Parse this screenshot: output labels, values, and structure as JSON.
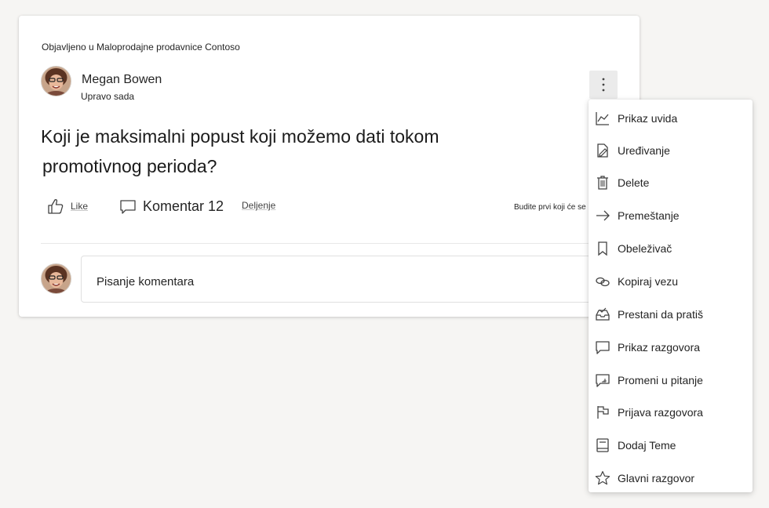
{
  "post": {
    "posted_in": "Objavljeno u Maloprodajne prodavnice Contoso",
    "author": "Megan Bowen",
    "time": "Upravo sada",
    "question_line1": "Koji je maksimalni popust koji možemo dati tokom",
    "question_line2": "promotivnog perioda?"
  },
  "actions": {
    "like": "Like",
    "comment": "Komentar 12",
    "share": "Deljenje",
    "seen": "Budite prvi koji će se razboleti"
  },
  "comment_box": {
    "placeholder": "Pisanje komentara"
  },
  "menu": {
    "items": [
      {
        "label": "Prikaz uvida",
        "icon": "chart-icon"
      },
      {
        "label": "Uređivanje",
        "icon": "edit-icon"
      },
      {
        "label": "Delete",
        "icon": "trash-icon"
      },
      {
        "label": "Premeštanje",
        "icon": "arrow-right-icon"
      },
      {
        "label": "Obeleživač",
        "icon": "bookmark-icon"
      },
      {
        "label": "Kopiraj vezu",
        "icon": "link-icon"
      },
      {
        "label": "Prestani da pratiš",
        "icon": "inbox-icon"
      },
      {
        "label": "Prikaz razgovora",
        "icon": "chat-icon"
      },
      {
        "label": "Promeni u pitanje",
        "icon": "chat-question-icon"
      },
      {
        "label": "Prijava razgovora",
        "icon": "flag-icon"
      },
      {
        "label": "Dodaj Teme",
        "icon": "topic-book-icon"
      },
      {
        "label": "Glavni razgovor",
        "icon": "star-icon"
      }
    ]
  }
}
